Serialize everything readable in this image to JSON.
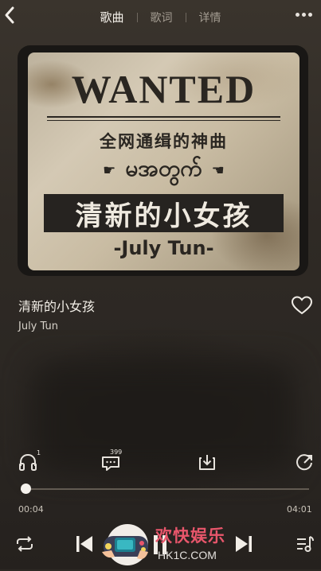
{
  "header": {
    "tabs": [
      {
        "label": "歌曲",
        "active": true
      },
      {
        "label": "歌词",
        "active": false
      },
      {
        "label": "详情",
        "active": false
      }
    ]
  },
  "cover": {
    "heading": "WANTED",
    "subtitle": "全网通缉的神曲",
    "myanmar": "မအတွက်",
    "banner": "清新的小女孩",
    "artist": "-July Tun-"
  },
  "song": {
    "title": "清新的小女孩",
    "artist": "July Tun"
  },
  "actions": {
    "listen_count": "1",
    "comment_count": "399"
  },
  "player": {
    "elapsed": "00:04",
    "duration": "04:01",
    "progress_fraction": 0.017
  },
  "watermark": {
    "line1": "欢快娱乐",
    "line2": "HK1C.COM"
  },
  "colors": {
    "accent": "#f4f1ec",
    "watermark": "#e8566b"
  }
}
